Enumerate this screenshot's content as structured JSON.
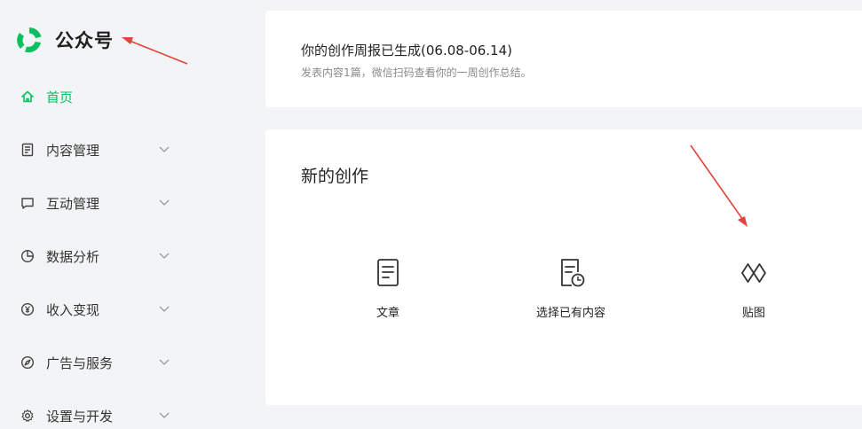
{
  "brand": {
    "name": "公众号",
    "accent_color": "#07c160",
    "logo_icon": "wechat-official-account-logo-icon"
  },
  "sidebar": {
    "items": [
      {
        "label": "首页",
        "icon": "home-icon",
        "active": true,
        "expandable": false
      },
      {
        "label": "内容管理",
        "icon": "document-icon",
        "active": false,
        "expandable": true
      },
      {
        "label": "互动管理",
        "icon": "chat-bubble-icon",
        "active": false,
        "expandable": true
      },
      {
        "label": "数据分析",
        "icon": "pie-chart-icon",
        "active": false,
        "expandable": true
      },
      {
        "label": "收入变现",
        "icon": "yen-coin-icon",
        "active": false,
        "expandable": true
      },
      {
        "label": "广告与服务",
        "icon": "compass-icon",
        "active": false,
        "expandable": true
      },
      {
        "label": "设置与开发",
        "icon": "gear-icon",
        "active": false,
        "expandable": true
      }
    ]
  },
  "report": {
    "title": "你的创作周报已生成(06.08-06.14)",
    "subtitle": "发表内容1篇，微信扫码查看你的一周创作总结。"
  },
  "create": {
    "title": "新的创作",
    "options": [
      {
        "label": "文章",
        "icon": "article-icon"
      },
      {
        "label": "选择已有内容",
        "icon": "existing-content-icon"
      },
      {
        "label": "贴图",
        "icon": "image-post-icon"
      }
    ]
  },
  "annotations": {
    "arrow_color": "#e0443f"
  }
}
